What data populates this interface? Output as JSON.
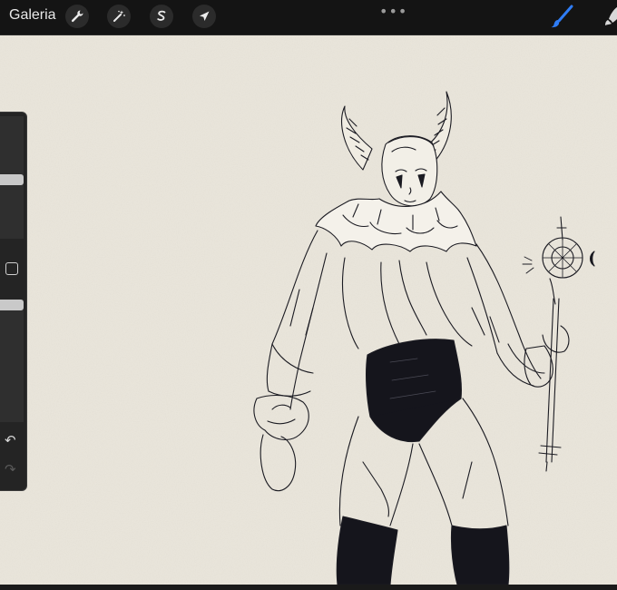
{
  "topbar": {
    "gallery_label": "Galeria",
    "tools": [
      {
        "name": "actions",
        "icon": "wrench-icon"
      },
      {
        "name": "adjustments",
        "icon": "magic-wand-icon"
      },
      {
        "name": "selection",
        "icon": "selection-s-icon"
      },
      {
        "name": "transform",
        "icon": "arrow-cursor-icon"
      }
    ],
    "more_label": "•••",
    "accent_color": "#2f7df6"
  },
  "sidebar": {
    "undo_label": "↶",
    "redo_label": "↷"
  }
}
